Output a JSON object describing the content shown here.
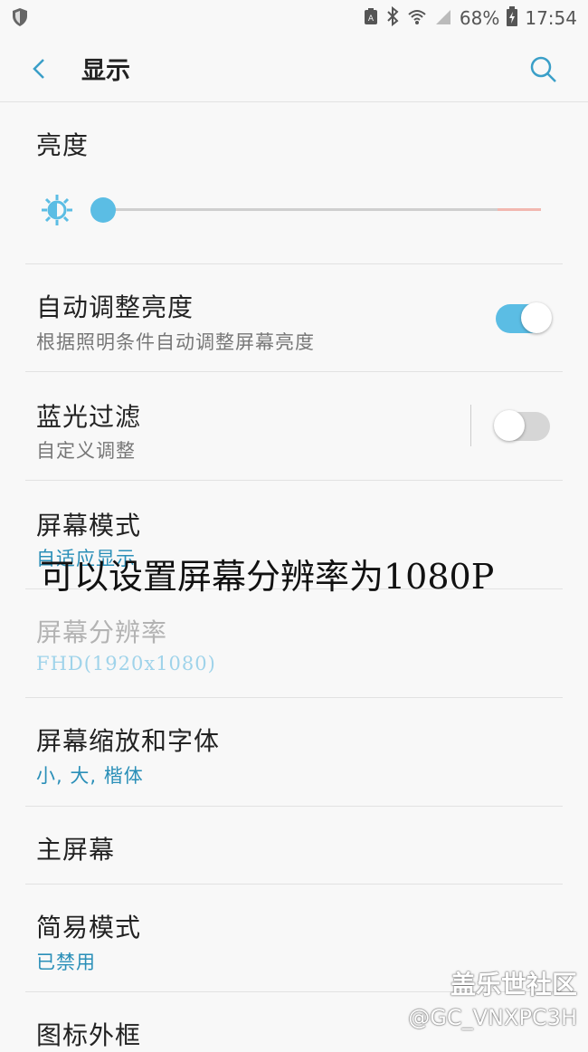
{
  "status": {
    "battery": "68%",
    "time": "17:54"
  },
  "header": {
    "title": "显示"
  },
  "brightness": {
    "label": "亮度",
    "level": 0.0
  },
  "rows": [
    {
      "title": "自动调整亮度",
      "subtitle": "根据照明条件自动调整屏幕亮度",
      "toggle": true
    },
    {
      "title": "蓝光过滤",
      "subtitle": "自定义调整",
      "toggle": false
    },
    {
      "title": "屏幕模式",
      "subtitle": "自适应显示"
    },
    {
      "title": "屏幕分辨率",
      "subtitle": "FHD(1920x1080)"
    },
    {
      "title": "屏幕缩放和字体",
      "subtitle": "小, 大, 楷体"
    },
    {
      "title": "主屏幕"
    },
    {
      "title": "简易模式",
      "subtitle": "已禁用"
    },
    {
      "title": "图标外框"
    }
  ],
  "overlay_text": "可以设置屏幕分辨率为1080P",
  "watermark": {
    "line1": "盖乐世社区",
    "line2": "@GC_VNXPC3H"
  },
  "colors": {
    "accent": "#5bbde4",
    "subtitle_accent": "#2a8fb8",
    "warn_track": "#f2b8b0"
  }
}
